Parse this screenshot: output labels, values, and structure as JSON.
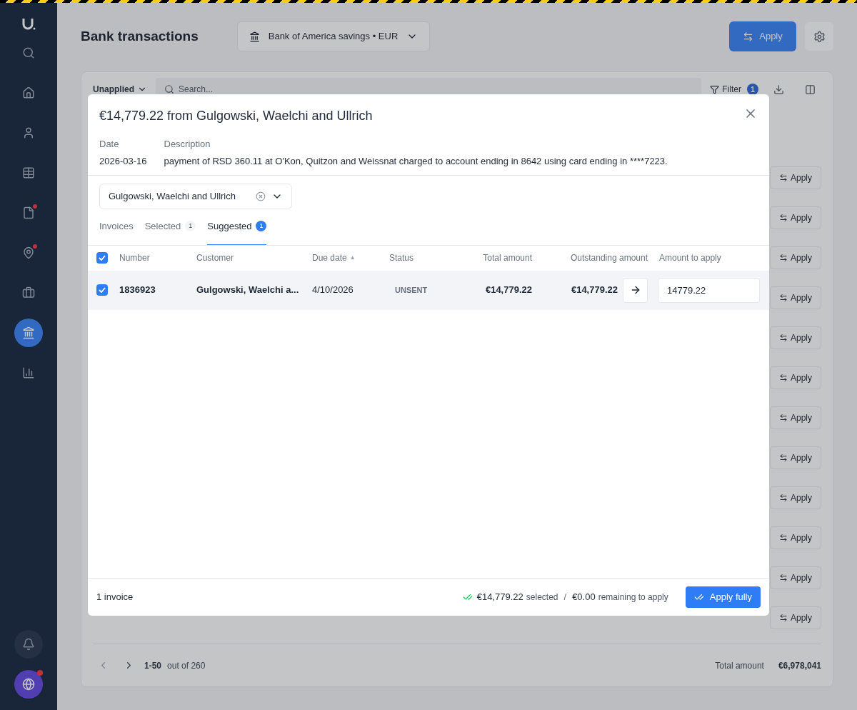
{
  "page": {
    "title": "Bank transactions",
    "account": "Bank of America savings • EUR",
    "apply": "Apply",
    "view": "Unapplied",
    "search_placeholder": "Search...",
    "filter": "Filter",
    "filter_count": "1",
    "row_actions": [
      "Apply",
      "Apply",
      "Apply",
      "Apply",
      "Apply",
      "Apply",
      "Apply",
      "Apply",
      "Apply",
      "Apply",
      "Apply",
      "Apply"
    ],
    "pagination": {
      "range": "1-50",
      "of": "out of 260"
    },
    "total_label": "Total amount",
    "total": "€6,978,041"
  },
  "sidebar": {
    "items": [
      {
        "kind": "search",
        "selected": false,
        "alert": false
      },
      {
        "kind": "home",
        "selected": false,
        "alert": false
      },
      {
        "kind": "user",
        "selected": false,
        "alert": false
      },
      {
        "kind": "table",
        "selected": false,
        "alert": false
      },
      {
        "kind": "file",
        "selected": false,
        "alert": true
      },
      {
        "kind": "pin",
        "selected": false,
        "alert": true
      },
      {
        "kind": "briefcase",
        "selected": false,
        "alert": false
      },
      {
        "kind": "bank",
        "selected": true,
        "alert": false
      },
      {
        "kind": "chart",
        "selected": false,
        "alert": false
      }
    ]
  },
  "modal": {
    "title": "€14,779.22 from Gulgowski, Waelchi and Ullrich",
    "date_label": "Date",
    "date": "2026-03-16",
    "description_label": "Description",
    "description": "payment of RSD 360.11 at O'Kon, Quitzon and Weissnat charged to account ending in 8642 using card ending in ****7223.",
    "customer_select": "Gulgowski, Waelchi and Ullrich",
    "tabs": [
      {
        "label": "Invoices",
        "selected": false
      },
      {
        "label": "Selected",
        "count": "1",
        "selected": false
      },
      {
        "label": "Suggested",
        "count": "1",
        "selected": true
      }
    ],
    "table": {
      "all_checked": true,
      "sort_indicator": "▲",
      "columns": [
        "Number",
        "Customer",
        "Due date",
        "Status",
        "Total amount",
        "Outstanding amount",
        "Amount to apply"
      ],
      "rows": [
        {
          "checked": true,
          "number": "1836923",
          "customer": "Gulgowski, Waelchi a...",
          "due_date": "4/10/2026",
          "status": "UNSENT",
          "total": "€14,779.22",
          "outstanding": "€14,779.22",
          "amount": "14779.22"
        }
      ]
    },
    "footer": {
      "count": "1 invoice",
      "selected_amount": "€14,779.22",
      "selected_label": "selected",
      "separator": "/",
      "remaining_amount": "€0.00",
      "remaining_label": "remaining to apply",
      "button": "Apply fully"
    }
  }
}
